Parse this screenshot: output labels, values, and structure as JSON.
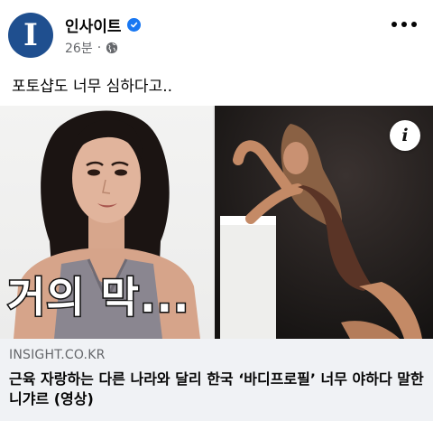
{
  "post": {
    "page_name": "인사이트",
    "avatar_letter": "I",
    "timestamp": "26분",
    "separator": "·",
    "text": "포토샵도 너무 심하다고.."
  },
  "media": {
    "caption_overlay": "거의 막...",
    "info_label": "i"
  },
  "link": {
    "domain": "INSIGHT.CO.KR",
    "title": "근육 자랑하는 다른 나라와 달리 한국 ‘바디프로필’ 너무 야하다 말한 니갸르 (영상)"
  },
  "colors": {
    "brand_blue": "#1f4f8f",
    "verified": "#1877f2",
    "preview_bg": "#f0f2f5",
    "meta_gray": "#65676b"
  }
}
